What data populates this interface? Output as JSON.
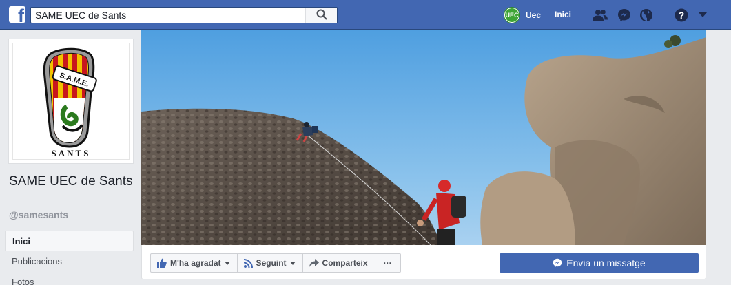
{
  "topbar": {
    "logo_letter": "f",
    "search": {
      "value": "SAME UEC de Sants"
    },
    "profile": {
      "name": "Uec"
    },
    "home_label": "Inici",
    "icons": [
      "friends-icon",
      "messenger-icon",
      "globe-icon",
      "help-icon",
      "caret-down-icon"
    ]
  },
  "page": {
    "name": "SAME UEC de Sants",
    "handle": "@samesants",
    "logo": {
      "badge_text": "S.A.M.E.",
      "caption": "SANTS"
    }
  },
  "left_nav": {
    "items": [
      {
        "label": "Inici",
        "active": true
      },
      {
        "label": "Publicacions",
        "active": false
      },
      {
        "label": "Fotos",
        "active": false
      }
    ]
  },
  "actions": {
    "like_label": "M'ha agradat",
    "follow_label": "Seguint",
    "share_label": "Comparteix",
    "more_label": "···",
    "message_label": "Envia un missatge"
  },
  "colors": {
    "brand": "#4267b2",
    "background": "#e9ebee",
    "sky": "#6aaee6"
  }
}
